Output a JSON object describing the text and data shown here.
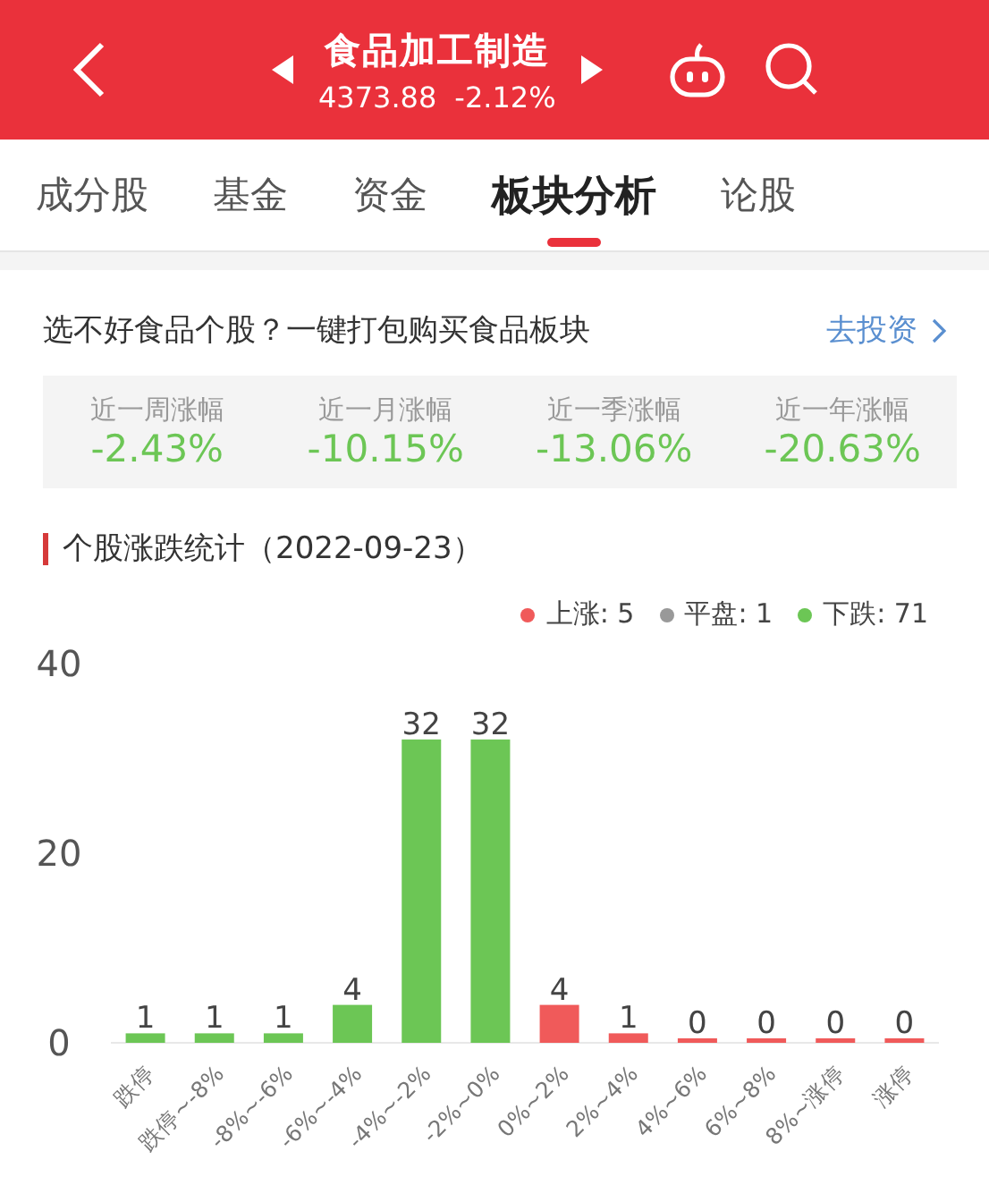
{
  "header": {
    "title": "食品加工制造",
    "price": "4373.88",
    "change": "-2.12%"
  },
  "tabs": [
    {
      "label": "成分股",
      "selected": false
    },
    {
      "label": "基金",
      "selected": false
    },
    {
      "label": "资金",
      "selected": false
    },
    {
      "label": "板块分析",
      "selected": true
    },
    {
      "label": "论股",
      "selected": false
    }
  ],
  "promo": {
    "text": "选不好食品个股？一键打包购买食品板块",
    "link": "去投资"
  },
  "stats": [
    {
      "label": "近一周涨幅",
      "value": "-2.43%"
    },
    {
      "label": "近一月涨幅",
      "value": "-10.15%"
    },
    {
      "label": "近一季涨幅",
      "value": "-13.06%"
    },
    {
      "label": "近一年涨幅",
      "value": "-20.63%"
    }
  ],
  "section": {
    "title": "个股涨跌统计（2022-09-23）",
    "legend": [
      {
        "label": "上涨: 5",
        "color": "#f05a5a"
      },
      {
        "label": "平盘: 1",
        "color": "#999999"
      },
      {
        "label": "下跌: 71",
        "color": "#6cc655"
      }
    ],
    "chart_data": {
      "type": "bar",
      "stacked": true,
      "data_labels": true,
      "yticks": [
        0,
        20,
        40
      ],
      "ylim": [
        0,
        40
      ],
      "categories": [
        "跌停",
        "跌停~-8%",
        "-8%~-6%",
        "-6%~-4%",
        "-4%~-2%",
        "-2%~0%",
        "0%~2%",
        "2%~4%",
        "4%~6%",
        "6%~8%",
        "8%~涨停",
        "涨停"
      ],
      "series": [
        {
          "color": "#6cc655",
          "values": [
            1,
            1,
            1,
            4,
            32,
            32,
            null,
            null,
            null,
            null,
            null,
            null
          ]
        },
        {
          "color": "#f05a5a",
          "values": [
            null,
            null,
            null,
            null,
            null,
            null,
            4,
            1,
            0,
            0,
            0,
            0
          ]
        }
      ]
    }
  }
}
